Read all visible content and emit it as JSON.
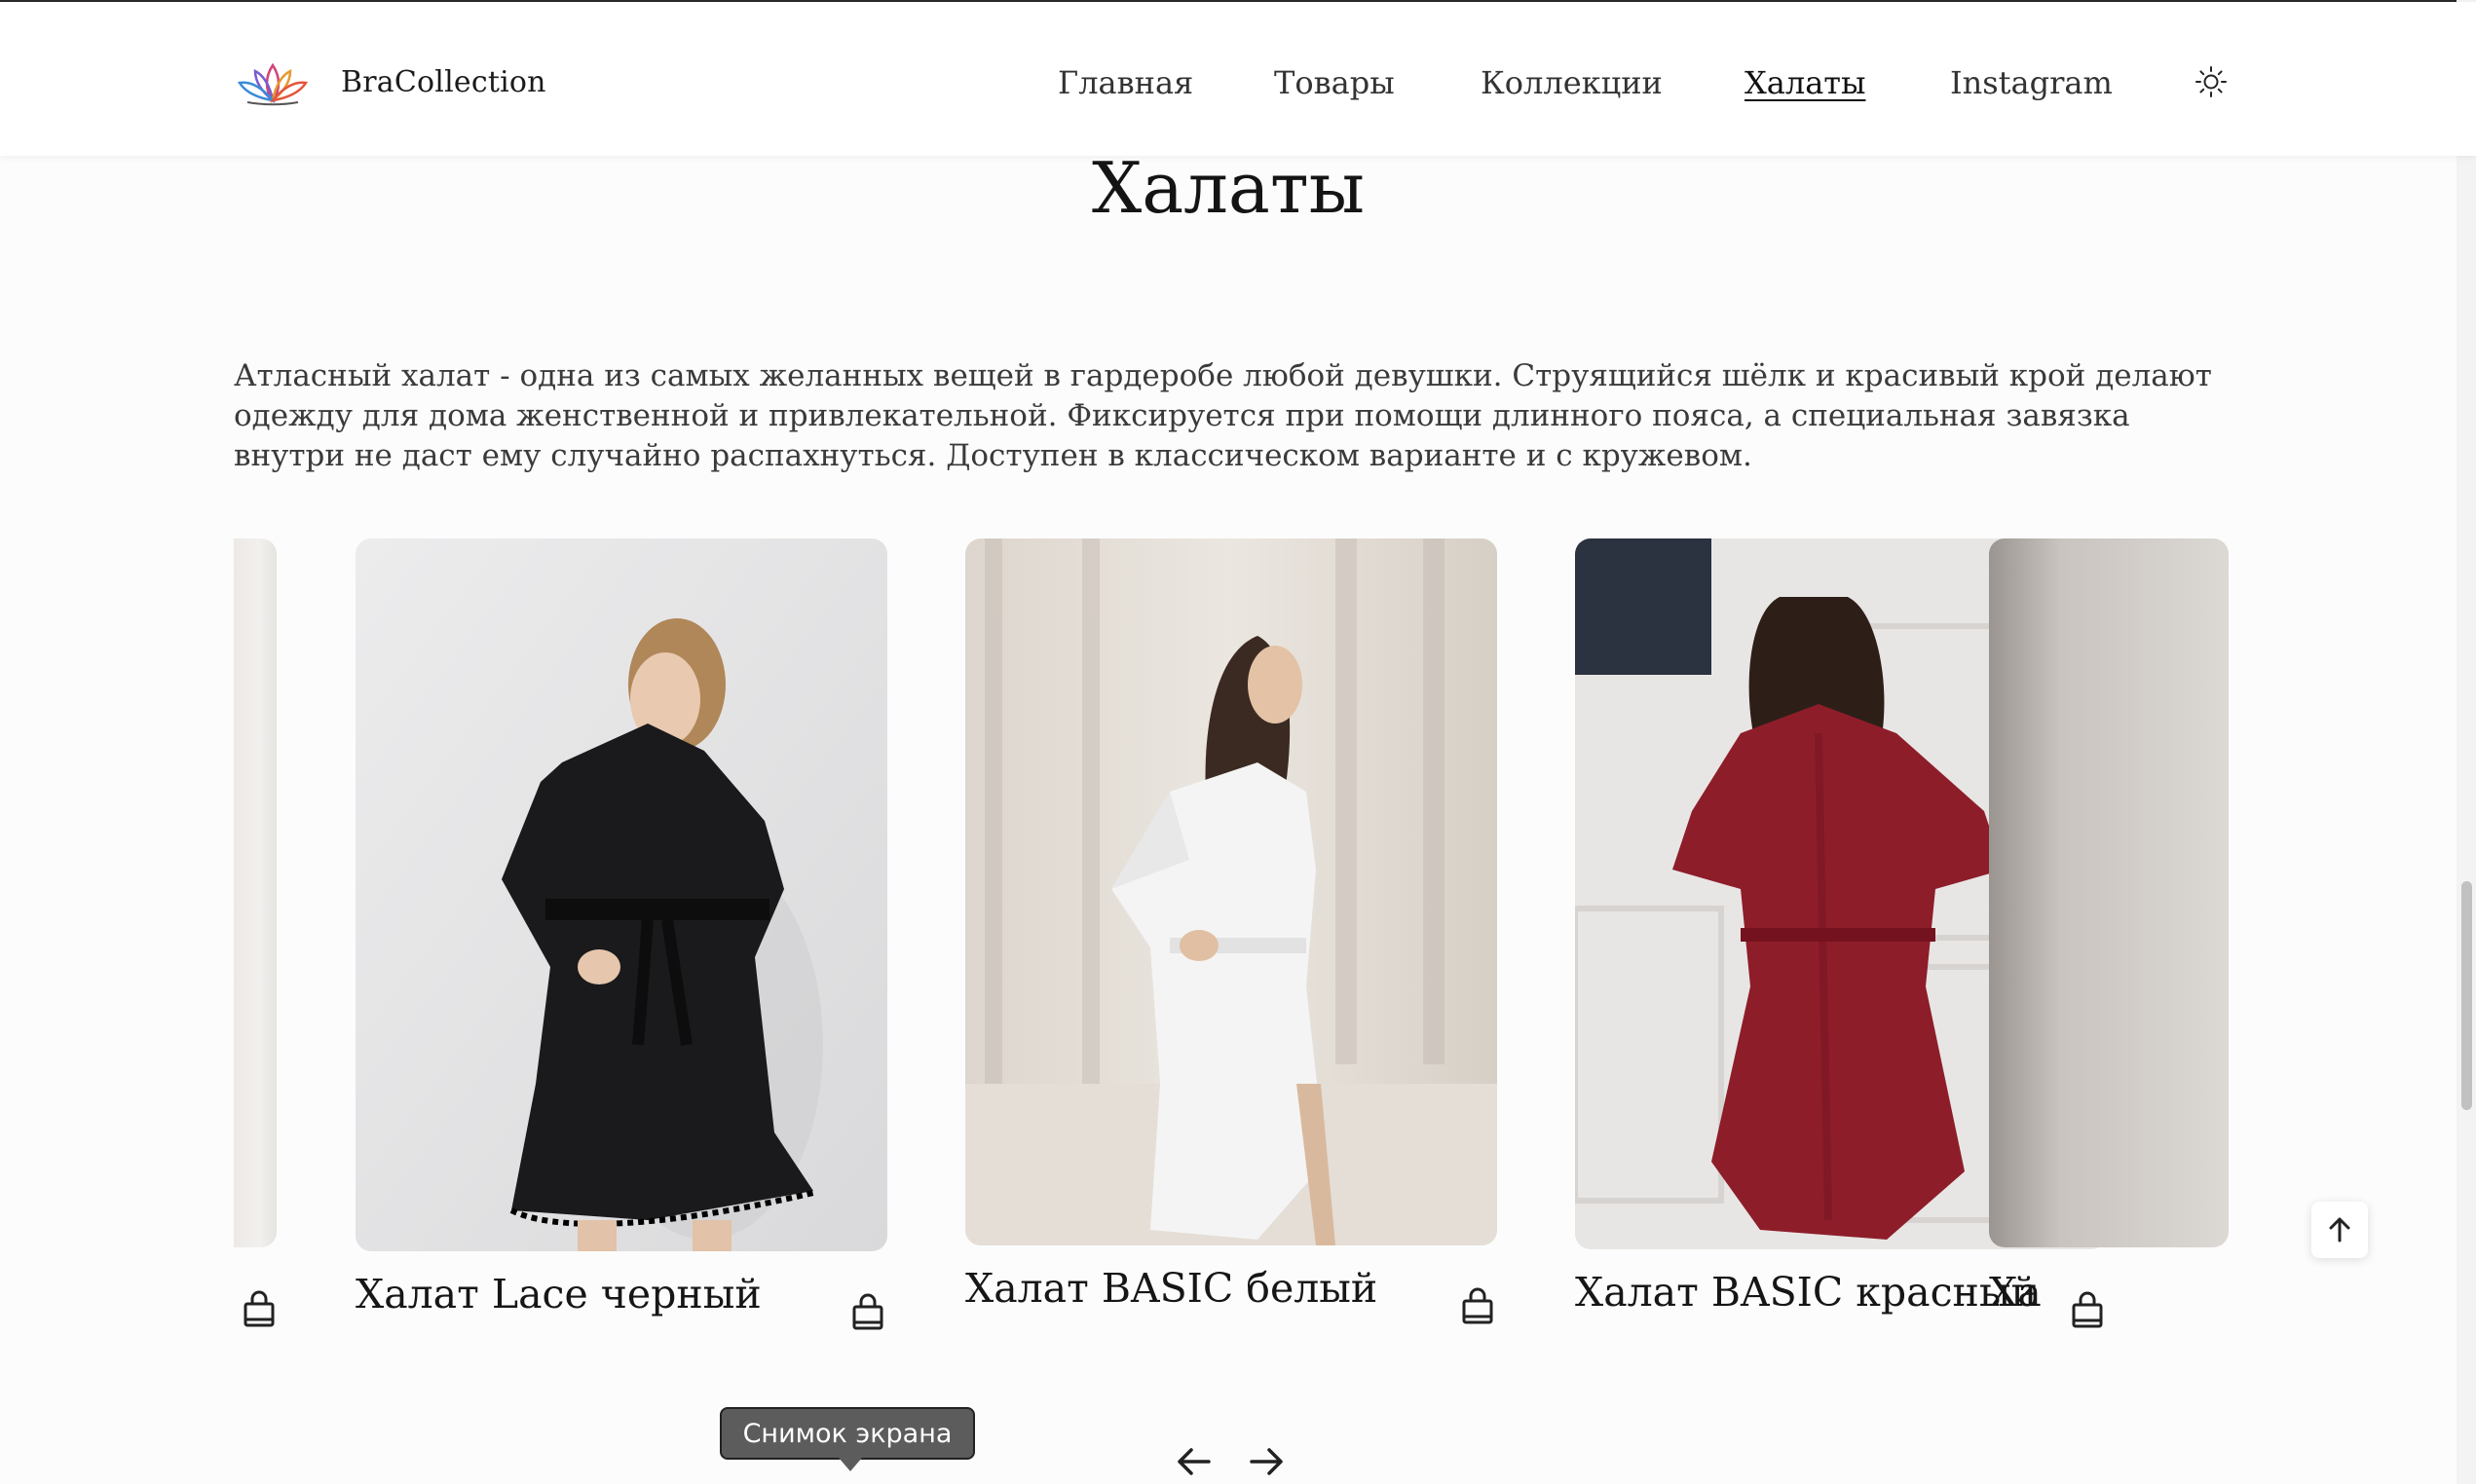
{
  "header": {
    "brand_name": "BraCollection",
    "nav": [
      {
        "label": "Главная",
        "active": false
      },
      {
        "label": "Товары",
        "active": false
      },
      {
        "label": "Коллекции",
        "active": false
      },
      {
        "label": "Халаты",
        "active": true
      },
      {
        "label": "Instagram",
        "active": false
      }
    ],
    "theme_icon": "sun-icon"
  },
  "page": {
    "title": "Халаты",
    "description": "Атласный халат - одна из самых желанных вещей в гардеробе любой девушки. Струящийся шёлк и красивый крой делают одежду для дома женственной и привлекательной. Фиксируется при помощи длинного пояса, а специальная завязка внутри не даст ему случайно распахнуться. Доступен в классическом варианте и с кружевом."
  },
  "carousel": {
    "products": [
      {
        "name": "Халат Lace черный",
        "robe_color": "#1a1a1c",
        "bg_color": "#e9e9ea"
      },
      {
        "name": "Халат BASIC белый",
        "robe_color": "#f4f4f4",
        "bg_color": "#e7e2dc"
      },
      {
        "name": "Халат BASIC красный",
        "robe_color": "#8e1d2a",
        "bg_color": "#e8e6e4"
      }
    ],
    "partial_right_label": "Ха",
    "prev_icon": "arrow-left-icon",
    "next_icon": "arrow-right-icon"
  },
  "tooltip": {
    "text": "Снимок экрана"
  },
  "scroll_top_icon": "arrow-up-icon"
}
